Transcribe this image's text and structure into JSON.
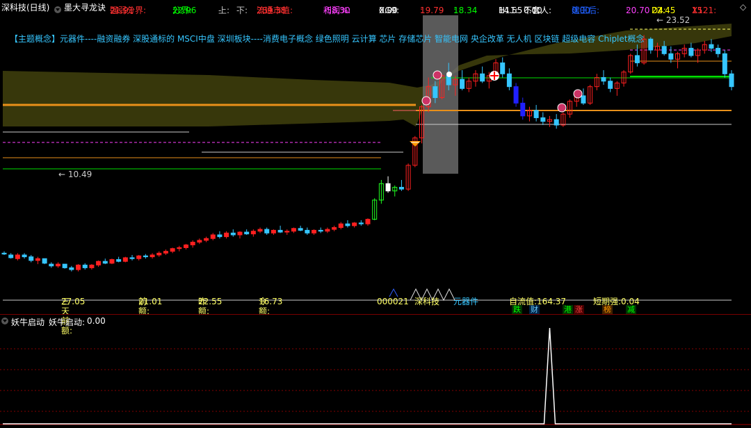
{
  "header": {
    "stock_name": "深科技(日线)",
    "formula_name": "墨大寻龙诀",
    "items": [
      {
        "label": "强弱分界:",
        "value": "21.91",
        "label_color": "#ff3030",
        "value_color": "#ff3030"
      },
      {
        "label": "分界:",
        "value": "22.96",
        "label_color": "#00ff00",
        "value_color": "#00ff00"
      },
      {
        "label": "上:",
        "value": "-",
        "label_color": "#cccccc",
        "value_color": "#cccccc"
      },
      {
        "label": "下:",
        "value": "-",
        "label_color": "#cccccc",
        "value_color": "#cccccc"
      },
      {
        "label": "流通市值:",
        "value": "289.38",
        "label_color": "#ff3030",
        "value_color": "#ff3030"
      },
      {
        "label": "利润%:",
        "value": "-58.30",
        "label_color": "#ff40ff",
        "value_color": "#ff40ff"
      },
      {
        "label": "XG9:",
        "value": "0.00",
        "label_color": "#ffffff",
        "value_color": "#ffffff"
      },
      {
        "label": ":",
        "value": "19.79",
        "label_color": "#ff3030",
        "value_color": "#ff3030"
      },
      {
        "label": ":",
        "value": "18.34",
        "label_color": "#00ff00",
        "value_color": "#00ff00"
      },
      {
        "label": "H11:",
        "value": "14.55",
        "label_color": "#ffffff",
        "value_color": "#ffffff"
      },
      {
        "label": "不套人:",
        "value": "0.00",
        "label_color": "#ffffff",
        "value_color": "#ffffff"
      },
      {
        "label": "建王后:",
        "value": "0.00",
        "label_color": "#2060ff",
        "value_color": "#2060ff"
      },
      {
        "label": ":",
        "value": "20.70",
        "label_color": "#ff40ff",
        "value_color": "#ff40ff"
      },
      {
        "label": "D4:",
        "value": "22.45",
        "label_color": "#ffff00",
        "value_color": "#ffff00"
      },
      {
        "label": "X121:",
        "value": "15.",
        "label_color": "#ff3030",
        "value_color": "#ff3030"
      }
    ]
  },
  "concepts_text": "【主题概念】元器件----融资融券 深股通标的 MSCI中盘 深圳板块----消费电子概念 绿色照明 云计算 芯片 存储芯片 智能电网 央企改革 无人机 区块链 超级电容 Chiplet概念",
  "chart_data": {
    "type": "candlestick",
    "price_range": [
      9.6,
      24.6
    ],
    "price_labels": {
      "high": "23.52",
      "low": "10.49"
    },
    "candles": [
      [
        11.6,
        11.7,
        11.5,
        11.55
      ],
      [
        11.5,
        11.6,
        11.3,
        11.35
      ],
      [
        11.3,
        11.6,
        11.2,
        11.5
      ],
      [
        11.5,
        11.6,
        11.3,
        11.4
      ],
      [
        11.4,
        11.5,
        11.1,
        11.2
      ],
      [
        11.2,
        11.4,
        11.0,
        11.3
      ],
      [
        11.3,
        11.3,
        11.0,
        11.05
      ],
      [
        11.0,
        11.1,
        10.8,
        10.9
      ],
      [
        10.9,
        11.1,
        10.8,
        11.0
      ],
      [
        11.0,
        11.0,
        10.75,
        10.8
      ],
      [
        10.8,
        10.9,
        10.6,
        10.7
      ],
      [
        10.7,
        11.0,
        10.6,
        10.95
      ],
      [
        10.95,
        11.05,
        10.7,
        10.8
      ],
      [
        10.8,
        11.0,
        10.7,
        10.95
      ],
      [
        10.95,
        11.2,
        10.85,
        11.15
      ],
      [
        11.15,
        11.3,
        11.0,
        11.05
      ],
      [
        11.05,
        11.3,
        11.0,
        11.25
      ],
      [
        11.25,
        11.4,
        11.1,
        11.15
      ],
      [
        11.15,
        11.4,
        11.1,
        11.35
      ],
      [
        11.35,
        11.5,
        11.2,
        11.3
      ],
      [
        11.3,
        11.5,
        11.2,
        11.45
      ],
      [
        11.45,
        11.55,
        11.3,
        11.4
      ],
      [
        11.4,
        11.6,
        11.3,
        11.5
      ],
      [
        11.5,
        11.7,
        11.4,
        11.6
      ],
      [
        11.6,
        11.8,
        11.5,
        11.7
      ],
      [
        11.7,
        11.9,
        11.6,
        11.85
      ],
      [
        11.85,
        12.0,
        11.7,
        11.9
      ],
      [
        11.9,
        12.1,
        11.8,
        12.05
      ],
      [
        12.05,
        12.3,
        11.9,
        12.2
      ],
      [
        12.2,
        12.4,
        12.1,
        12.3
      ],
      [
        12.3,
        12.5,
        12.2,
        12.4
      ],
      [
        12.4,
        12.7,
        12.3,
        12.6
      ],
      [
        12.6,
        12.8,
        12.4,
        12.5
      ],
      [
        12.5,
        12.8,
        12.4,
        12.7
      ],
      [
        12.7,
        12.9,
        12.5,
        12.6
      ],
      [
        12.6,
        12.8,
        12.4,
        12.75
      ],
      [
        12.75,
        12.9,
        12.6,
        12.65
      ],
      [
        12.65,
        12.9,
        12.5,
        12.8
      ],
      [
        12.8,
        13.0,
        12.7,
        12.9
      ],
      [
        12.9,
        13.0,
        12.6,
        12.7
      ],
      [
        12.7,
        12.9,
        12.6,
        12.85
      ],
      [
        12.85,
        13.1,
        12.7,
        12.75
      ],
      [
        12.75,
        12.9,
        12.6,
        12.8
      ],
      [
        12.8,
        13.0,
        12.7,
        12.95
      ],
      [
        12.95,
        13.1,
        12.8,
        12.85
      ],
      [
        12.85,
        13.0,
        12.6,
        12.7
      ],
      [
        12.7,
        12.9,
        12.6,
        12.85
      ],
      [
        12.85,
        13.0,
        12.7,
        12.8
      ],
      [
        12.8,
        13.0,
        12.7,
        12.9
      ],
      [
        12.9,
        13.1,
        12.8,
        13.0
      ],
      [
        13.0,
        13.3,
        12.9,
        13.2
      ],
      [
        13.2,
        13.4,
        13.0,
        13.1
      ],
      [
        13.1,
        13.3,
        13.0,
        13.25
      ],
      [
        13.25,
        13.4,
        13.1,
        13.2
      ],
      [
        13.2,
        13.5,
        13.1,
        13.45
      ],
      [
        13.45,
        14.6,
        13.4,
        14.5
      ],
      [
        14.5,
        15.6,
        14.3,
        15.4
      ],
      [
        15.4,
        15.8,
        14.9,
        15.0
      ],
      [
        15.0,
        15.3,
        14.7,
        15.2
      ],
      [
        15.2,
        15.6,
        15.0,
        15.1
      ],
      [
        15.1,
        16.5,
        15.0,
        16.4
      ],
      [
        16.4,
        18.0,
        16.3,
        17.9
      ],
      [
        17.9,
        19.7,
        17.6,
        19.6
      ],
      [
        19.6,
        21.2,
        19.3,
        20.7
      ],
      [
        20.7,
        21.0,
        19.8,
        20.1
      ],
      [
        20.1,
        21.4,
        20.0,
        21.3
      ],
      [
        21.3,
        22.0,
        20.5,
        20.8
      ],
      [
        20.8,
        21.3,
        20.2,
        21.1
      ],
      [
        21.1,
        21.6,
        20.5,
        20.6
      ],
      [
        20.6,
        21.2,
        20.4,
        21.0
      ],
      [
        21.0,
        21.6,
        20.7,
        21.4
      ],
      [
        21.4,
        21.8,
        20.9,
        21.0
      ],
      [
        21.0,
        21.5,
        20.6,
        21.3
      ],
      [
        21.3,
        22.2,
        21.1,
        22.0
      ],
      [
        22.0,
        22.3,
        21.2,
        21.4
      ],
      [
        21.4,
        21.7,
        20.5,
        20.7
      ],
      [
        20.7,
        20.9,
        19.6,
        19.8
      ],
      [
        19.8,
        20.1,
        18.9,
        19.1
      ],
      [
        19.1,
        19.6,
        18.8,
        19.4
      ],
      [
        19.4,
        19.7,
        18.8,
        19.0
      ],
      [
        19.0,
        19.3,
        18.6,
        18.8
      ],
      [
        18.8,
        19.1,
        18.5,
        18.9
      ],
      [
        18.9,
        19.2,
        18.4,
        18.6
      ],
      [
        18.6,
        19.3,
        18.5,
        19.2
      ],
      [
        19.2,
        20.0,
        19.0,
        19.9
      ],
      [
        19.9,
        20.4,
        19.6,
        20.2
      ],
      [
        20.2,
        20.6,
        19.7,
        19.8
      ],
      [
        19.8,
        20.8,
        19.7,
        20.7
      ],
      [
        20.7,
        21.4,
        20.5,
        21.2
      ],
      [
        21.2,
        21.6,
        20.8,
        21.0
      ],
      [
        21.0,
        21.2,
        20.4,
        20.6
      ],
      [
        20.6,
        21.0,
        20.2,
        20.9
      ],
      [
        20.9,
        21.6,
        20.7,
        21.5
      ],
      [
        21.5,
        22.5,
        21.4,
        22.4
      ],
      [
        22.4,
        23.0,
        21.8,
        22.0
      ],
      [
        22.0,
        23.52,
        21.9,
        23.3
      ],
      [
        23.3,
        23.4,
        22.5,
        22.7
      ],
      [
        22.7,
        23.1,
        22.3,
        22.9
      ],
      [
        22.9,
        23.2,
        22.4,
        22.5
      ],
      [
        22.5,
        22.9,
        22.0,
        22.2
      ],
      [
        22.2,
        22.6,
        21.7,
        22.5
      ],
      [
        22.5,
        23.0,
        22.3,
        22.8
      ],
      [
        22.8,
        23.1,
        22.3,
        22.4
      ],
      [
        22.4,
        22.8,
        22.0,
        22.7
      ],
      [
        22.7,
        23.2,
        22.5,
        23.0
      ],
      [
        23.0,
        23.3,
        22.6,
        22.8
      ],
      [
        22.8,
        23.0,
        22.3,
        22.5
      ],
      [
        22.5,
        22.7,
        21.2,
        21.4
      ],
      [
        21.4,
        21.6,
        20.5,
        20.7
      ]
    ],
    "lines": [
      {
        "name": "orange-level",
        "color": "#e8901a",
        "price": 19.4
      },
      {
        "name": "white-level",
        "color": "#dddddd",
        "price": 18.4
      },
      {
        "name": "green-level",
        "color": "#00e000",
        "price": 20.3
      }
    ]
  },
  "bottom_info": {
    "items": [
      {
        "label": "三天前额:",
        "value": "27.05",
        "color": "#ffff66"
      },
      {
        "label": "前额:",
        "value": "21.01",
        "color": "#ffff66"
      },
      {
        "label": "昨额:",
        "value": "22.55",
        "color": "#ffff66"
      },
      {
        "label": "今额:",
        "value": "16.73",
        "color": "#ffff66"
      }
    ],
    "code": "000021",
    "name": "深科技",
    "sector": "元器件",
    "float_value": "自流值:164.37",
    "short_strength": "短期强:0.04",
    "flags": [
      {
        "text": "跌",
        "color": "#00ff00",
        "bg": "#003300"
      },
      {
        "text": "财",
        "color": "#66ccff",
        "bg": "#002244"
      },
      {
        "text": "港",
        "color": "#00ff00",
        "bg": "#003300"
      },
      {
        "text": "涨",
        "color": "#ff4040",
        "bg": "#440000"
      },
      {
        "text": "榜",
        "color": "#ff9900",
        "bg": "#442200"
      },
      {
        "text": "减",
        "color": "#00ff00",
        "bg": "#003300"
      }
    ]
  },
  "sub_indicator": {
    "name": "妖牛启动",
    "label": "妖牛启动:",
    "value": "0.00",
    "spike_index": 81
  }
}
